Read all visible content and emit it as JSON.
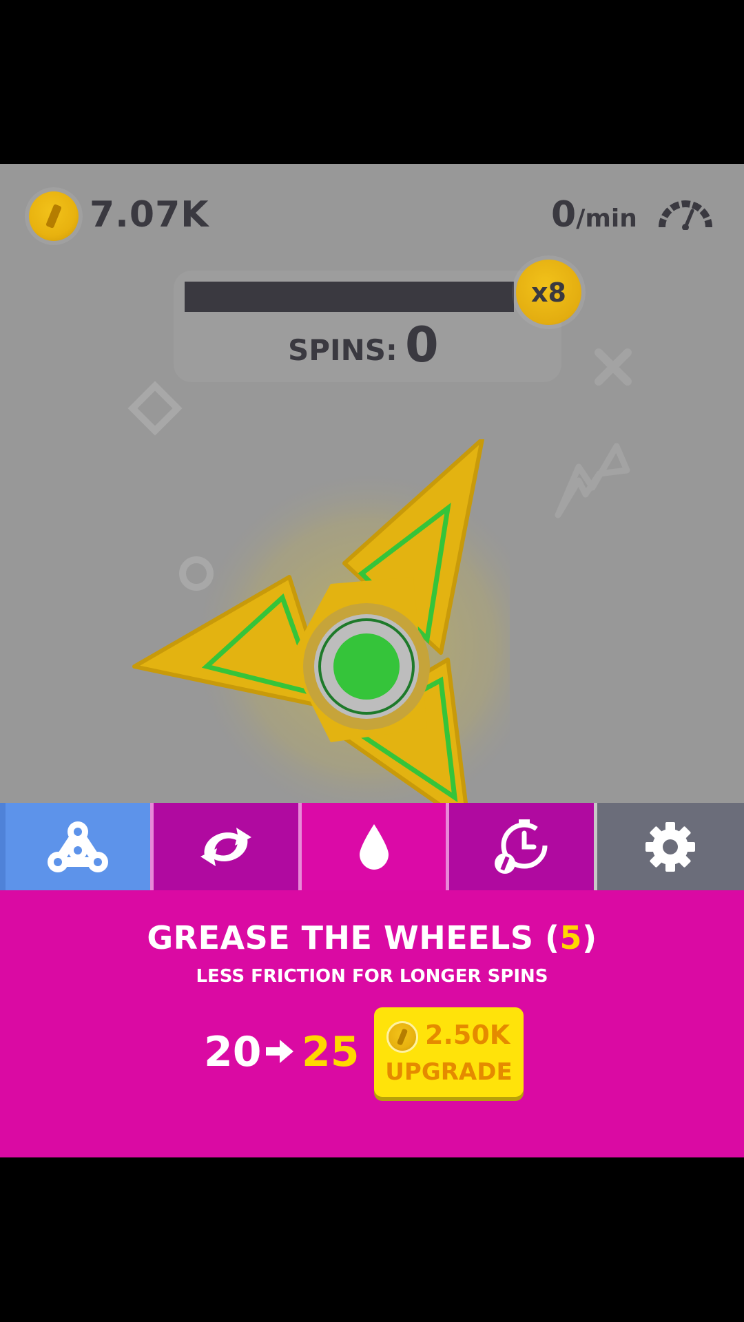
{
  "hud": {
    "coins": "7.07K",
    "coin_icon": "coin-icon",
    "rate_value": "0",
    "rate_unit": "/min",
    "gauge_icon": "speedometer-icon"
  },
  "spins_panel": {
    "progress": 0,
    "multiplier": "x8",
    "label": "SPINS:",
    "value": "0"
  },
  "tabs": [
    {
      "icon": "fidget-spinner-icon",
      "color": "#5d93ea",
      "selected": false
    },
    {
      "icon": "refresh-arrows-icon",
      "color": "#b00aa0",
      "selected": false
    },
    {
      "icon": "oil-drop-icon",
      "color": "#db0aa7",
      "selected": true
    },
    {
      "icon": "timer-coin-icon",
      "color": "#b00aa0",
      "selected": false
    },
    {
      "icon": "gear-icon",
      "color": "#6b6d7a",
      "selected": false
    }
  ],
  "upgrade": {
    "title": "GREASE THE WHEELS (",
    "level": "5",
    "title_end": ")",
    "subtitle": "LESS FRICTION FOR LONGER SPINS",
    "from_value": "20",
    "to_value": "25",
    "price": "2.50K",
    "button_label": "UPGRADE"
  },
  "colors": {
    "panel": "#da0aa3",
    "accent_yellow": "#ffd800",
    "spinner_body": "#e3b311",
    "spinner_glow": "#35c43a"
  }
}
